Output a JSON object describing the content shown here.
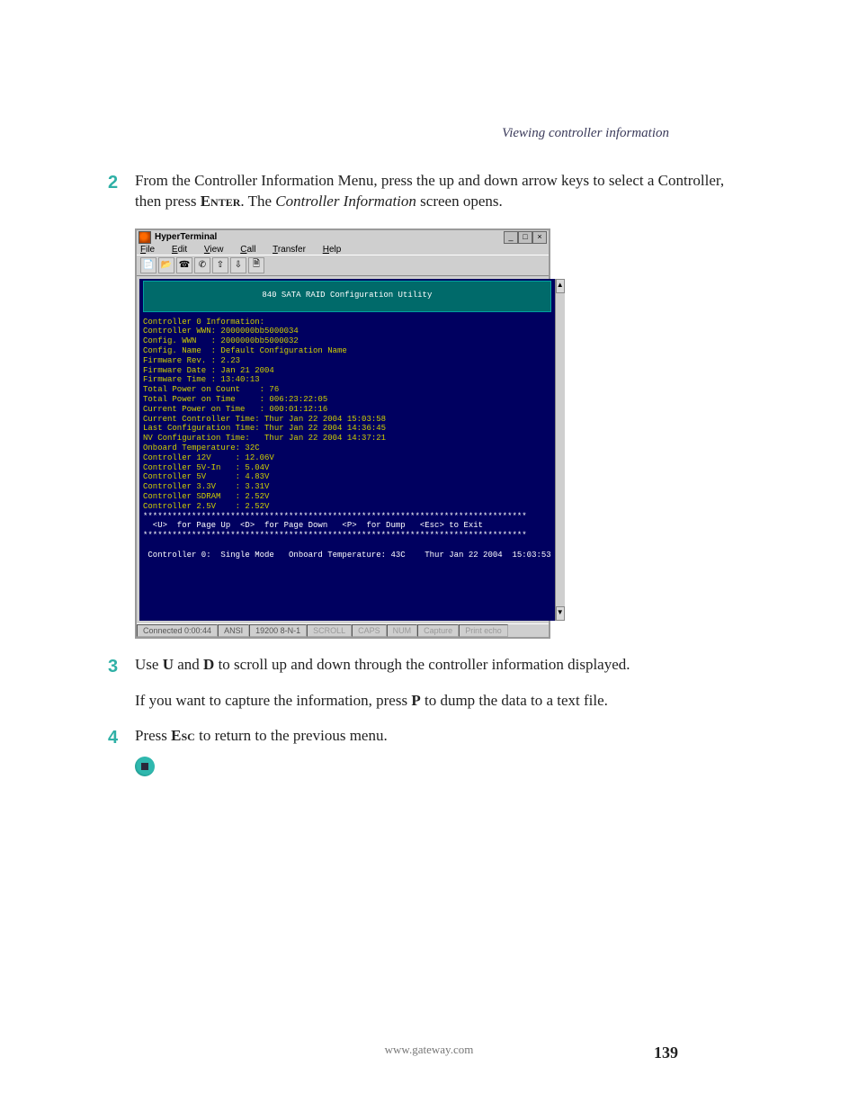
{
  "running_head": "Viewing controller information",
  "step2": {
    "num": "2",
    "text_a": "From the Controller Information Menu, press the up and down arrow keys to select a Controller, then press ",
    "enter": "Enter",
    "text_b": ". The ",
    "ci": "Controller Information",
    "text_c": " screen opens."
  },
  "ht": {
    "title": "HyperTerminal",
    "menubar": [
      "File",
      "Edit",
      "View",
      "Call",
      "Transfer",
      "Help"
    ],
    "toolbar_icons": [
      "new-file-icon",
      "open-folder-icon",
      "call-icon",
      "hangup-icon",
      "send-icon",
      "receive-icon",
      "properties-icon"
    ],
    "win_buttons": {
      "min": "_",
      "max": "□",
      "close": "×"
    },
    "scroll": {
      "up": "▲",
      "down": "▼"
    },
    "term_header": "840 SATA RAID Configuration Utility",
    "lines": [
      "Controller 0 Information:",
      "",
      "Controller WWN: 2000000bb5000034",
      "Config. WWN   : 2000000bb5000032",
      "Config. Name  : Default Configuration Name",
      "Firmware Rev. : 2.23",
      "Firmware Date : Jan 21 2004",
      "Firmware Time : 13:40:13",
      "",
      "Total Power on Count    : 76",
      "Total Power on Time     : 006:23:22:05",
      "Current Power on Time   : 000:01:12:16",
      "Current Controller Time: Thur Jan 22 2004 15:03:58",
      "Last Configuration Time: Thur Jan 22 2004 14:36:45",
      "NV Configuration Time:   Thur Jan 22 2004 14:37:21",
      "",
      "Onboard Temperature: 32C",
      "Controller 12V     : 12.06V",
      "Controller 5V-In   : 5.04V",
      "Controller 5V      : 4.83V",
      "Controller 3.3V    : 3.31V",
      "Controller SDRAM   : 2.52V",
      "Controller 2.5V    : 2.52V",
      ""
    ],
    "div_line": "*******************************************************************************",
    "cmd_line": "  <U>  for Page Up  <D>  for Page Down   <P>  for Dump   <Esc> to Exit",
    "status_line": " Controller 0:  Single Mode   Onboard Temperature: 43C    Thur Jan 22 2004  15:03:53",
    "statusbar": {
      "conn": "Connected 0:00:44",
      "emu": "ANSI",
      "cfg": "19200 8-N-1",
      "dim": [
        "SCROLL",
        "CAPS",
        "NUM",
        "Capture",
        "Print echo"
      ]
    }
  },
  "step3": {
    "num": "3",
    "a": "Use ",
    "U": "U",
    "b": " and ",
    "D": "D",
    "c": " to scroll up and down through the controller information displayed."
  },
  "step3b": {
    "a": "If you want to capture the information, press ",
    "P": "P",
    "b": " to dump the data to a text file."
  },
  "step4": {
    "num": "4",
    "a": "Press ",
    "esc": "Esc",
    "b": " to return to the previous menu."
  },
  "footer_url": "www.gateway.com",
  "page_number": "139"
}
